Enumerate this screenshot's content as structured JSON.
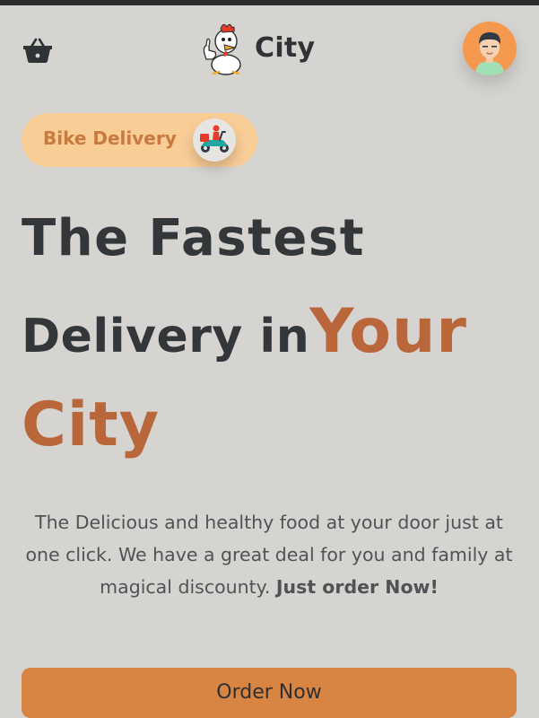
{
  "header": {
    "logo_text": "City",
    "cart_icon": "basket-icon",
    "logo_icon": "chicken-mascot-icon",
    "avatar_icon": "user-avatar-icon"
  },
  "badge": {
    "label": "Bike Delivery",
    "icon": "delivery-scooter-icon"
  },
  "hero": {
    "line1": "The Fastest",
    "line2_text": "Delivery in",
    "line2_accent": "Your",
    "line3": "City"
  },
  "description": {
    "text": "The Delicious and healthy food at your door just at one click. We have a great deal for you and family at magical discounty. ",
    "bold": "Just order Now!"
  },
  "cta": {
    "label": "Order Now"
  },
  "colors": {
    "background": "#d6d4d1",
    "accent": "#b8663a",
    "pill_bg": "#f9cd96",
    "pill_text": "#c97a3f",
    "button_bg": "#d88544",
    "heading": "#343739"
  }
}
